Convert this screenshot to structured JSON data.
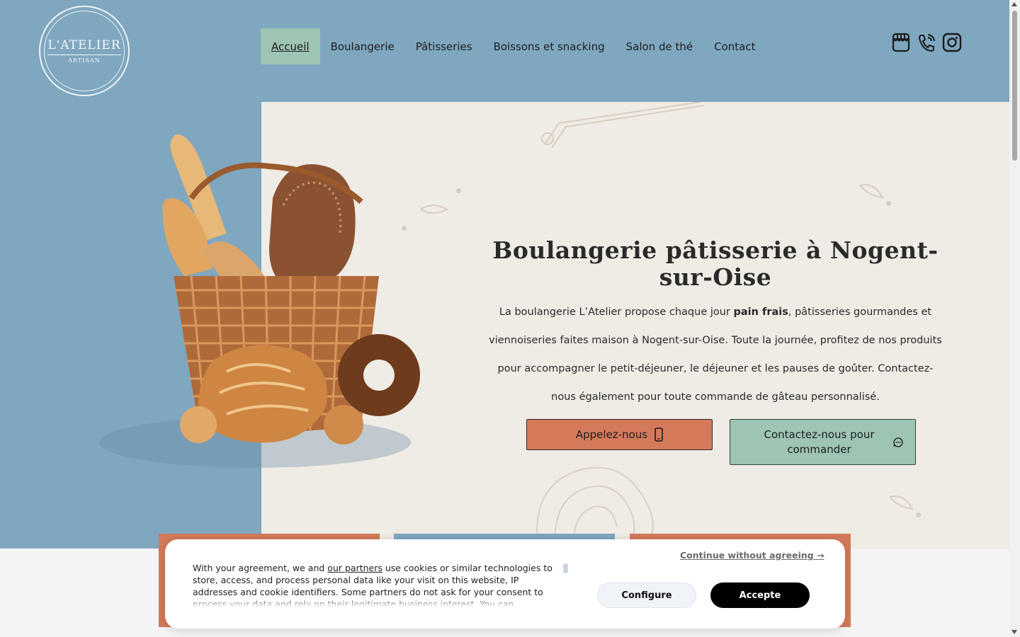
{
  "logo": {
    "title": "L'ATELIER",
    "subtitle": "ARTISAN"
  },
  "nav": {
    "items": [
      {
        "label": "Accueil",
        "active": true
      },
      {
        "label": "Boulangerie"
      },
      {
        "label": "Pâtisseries"
      },
      {
        "label": "Boissons et snacking"
      },
      {
        "label": "Salon de thé"
      },
      {
        "label": "Contact"
      }
    ]
  },
  "header_icons": [
    "storefront-icon",
    "phone-icon",
    "instagram-icon"
  ],
  "hero": {
    "title": "Boulangerie pâtisserie à Nogent-sur-Oise",
    "text_before": "La boulangerie L’Atelier propose chaque jour ",
    "text_bold": "pain frais",
    "text_after": ", pâtisseries gourmandes et viennoiseries faites maison à Nogent-sur-Oise. Toute la journée, profitez de nos produits pour accompagner le petit-déjeuner, le déjeuner et les pauses de goûter. Contactez-nous également pour toute commande de gâteau personnalisé.",
    "call_button": "Appelez-nous",
    "contact_button": "Contactez-nous pour commander"
  },
  "cookie": {
    "text_before": "With your agreement, we and ",
    "link": "our partners",
    "text_after": " use cookies or similar technologies to store, access, and process personal data like your visit on this website, IP addresses and cookie identifiers. Some partners do not ask for your consent to process your data and rely on their legitimate business interest. You can",
    "continue": "Continue without agreeing →",
    "configure": "Configure",
    "accept": "Accepte"
  },
  "colors": {
    "header_blue": "#7fa7c0",
    "hero_beige": "#efebe5",
    "terracotta": "#d47a5b",
    "sage": "#9ec4b3"
  }
}
